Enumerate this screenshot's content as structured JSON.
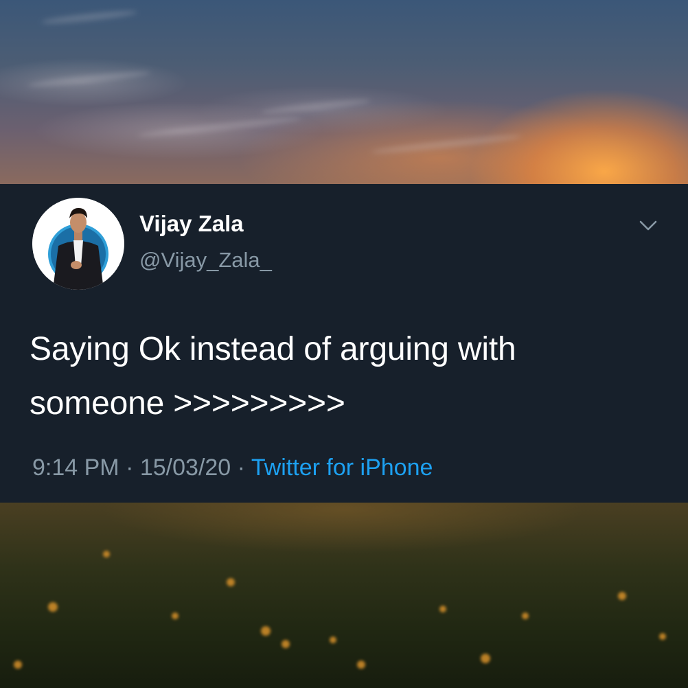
{
  "tweet": {
    "display_name": "Vijay Zala",
    "handle": "@Vijay_Zala_",
    "text_line1": "Saying Ok instead of arguing with",
    "text_line2": "someone >>>>>>>>>",
    "time": "9:14 PM",
    "separator": "·",
    "date": "15/03/20",
    "source": "Twitter for iPhone",
    "menu_icon": "chevron-down-icon"
  },
  "colors": {
    "card_background": "#17202b",
    "primary_text": "#ffffff",
    "secondary_text": "#8899a6",
    "link": "#1da1f2"
  }
}
